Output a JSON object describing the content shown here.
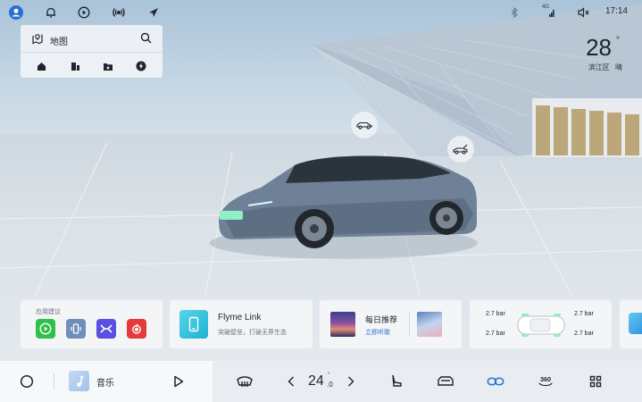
{
  "status_bar": {
    "time": "17:14",
    "network": "4G",
    "icons": [
      "profile-icon",
      "bell-icon",
      "play-circle-icon",
      "broadcast-icon",
      "navigation-arrow-icon",
      "bluetooth-icon",
      "signal-icon",
      "volume-icon"
    ]
  },
  "map_widget": {
    "title": "地图",
    "icons": [
      "map-pin-icon",
      "search-icon"
    ],
    "quick_actions": [
      "home-icon",
      "office-icon",
      "favorite-folder-icon",
      "charging-icon"
    ]
  },
  "weather": {
    "temperature": "28",
    "unit": "°",
    "district": "滨江区",
    "condition": "晴"
  },
  "scene_hotspots": [
    "car-body-icon",
    "trunk-icon"
  ],
  "cards": {
    "apps": {
      "label": "应用建议",
      "apps": [
        {
          "icon": "video-play-app-icon",
          "color": "#2fbf4a"
        },
        {
          "icon": "phone-app-icon",
          "color": "#6d8fb8"
        },
        {
          "icon": "link-app-icon",
          "color": "#5a4fe0"
        },
        {
          "icon": "netease-music-app-icon",
          "color": "#e53a3a"
        }
      ]
    },
    "flyme": {
      "title": "Flyme Link",
      "subtitle": "突破壁垒，打破无界生态"
    },
    "recommend": {
      "title": "每日推荐",
      "link": "立即听歌"
    },
    "tires": {
      "front_left": "2.7 bar",
      "front_right": "2.7 bar",
      "rear_left": "2.7 bar",
      "rear_right": "2.7 bar"
    }
  },
  "dock": {
    "music_label": "音乐",
    "temperature": "24",
    "temperature_decimal": ".0",
    "temperature_degree": "°",
    "items": [
      "home-circle-icon",
      "music-note-icon",
      "play-icon",
      "defrost-icon",
      "chevron-left-icon",
      "chevron-right-icon",
      "seat-icon",
      "car-control-icon",
      "link-icon",
      "camera-360-icon",
      "apps-grid-icon"
    ],
    "accent": "#2a6fd6"
  }
}
